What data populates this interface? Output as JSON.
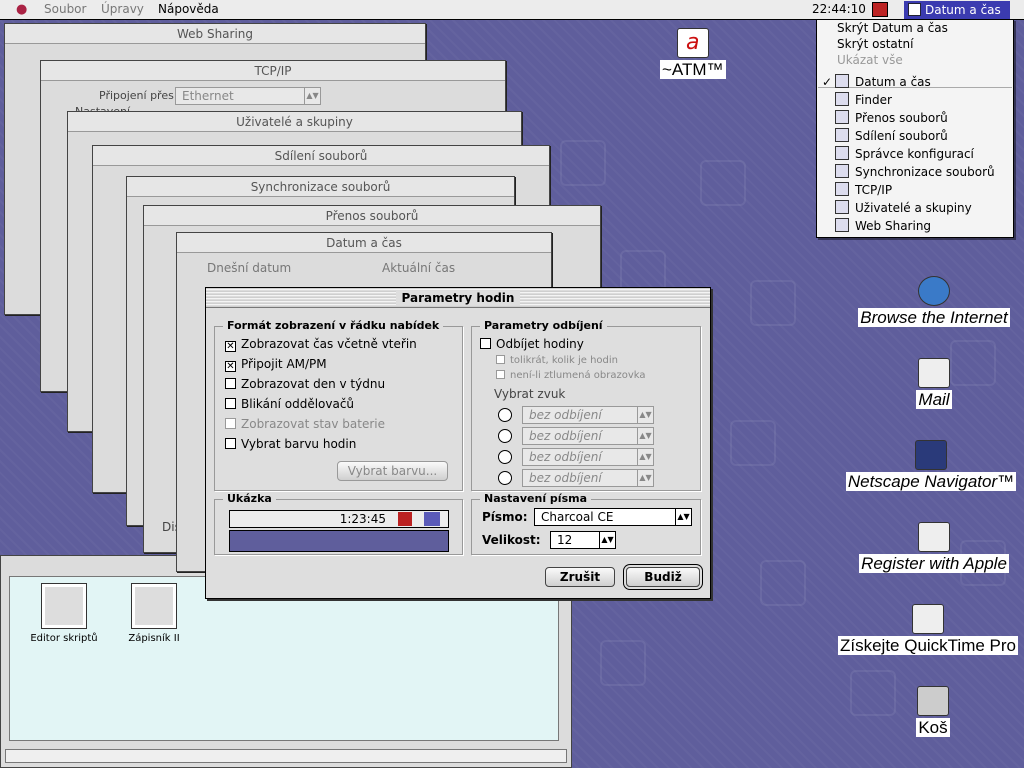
{
  "menubar": {
    "items": [
      "Soubor",
      "Úpravy",
      "Nápověda"
    ],
    "clock": "22:44:10",
    "app_menu": "Datum a čas"
  },
  "app_dropdown": {
    "top_items": [
      "Skrýt Datum a čas",
      "Skrýt ostatní",
      "Ukázat vše"
    ],
    "apps": [
      "Datum a čas",
      "Finder",
      "Přenos souborů",
      "Sdílení souborů",
      "Správce konfigurací",
      "Synchronizace souborů",
      "TCP/IP",
      "Uživatelé a skupiny",
      "Web Sharing"
    ],
    "checked": "Datum a čas"
  },
  "background_windows": {
    "web_sharing": "Web Sharing",
    "tcpip": "TCP/IP",
    "tcpip_connect_label": "Připojení přes:",
    "tcpip_connect_value": "Ethernet",
    "tcpip_settings": "Nastavení",
    "users": "Uživatelé a skupiny",
    "file_sharing": "Sdílení souborů",
    "sync": "Synchronizace souborů",
    "transfer": "Přenos souborů",
    "datetime": "Datum a čas",
    "today": "Dnešní datum",
    "current_time": "Aktuální čas",
    "dis": "Dis"
  },
  "dialog": {
    "title": "Parametry hodin",
    "menubar_group": "Formát zobrazení v řádku nabídek",
    "show_seconds": "Zobrazovat čas včetně vteřin",
    "ampm": "Připojit AM/PM",
    "weekday": "Zobrazovat den v týdnu",
    "blink": "Blikání oddělovačů",
    "battery": "Zobrazovat stav baterie",
    "color": "Vybrat barvu hodin",
    "choose_color": "Vybrat barvu...",
    "chime_group": "Parametry odbíjení",
    "chime": "Odbíjet hodiny",
    "times": "tolikrát, kolik je hodin",
    "dimmed": "není-li ztlumená obrazovka",
    "choose_sound": "Vybrat zvuk",
    "sounds": [
      "bez odbíjení",
      "bez odbíjení",
      "bez odbíjení",
      "bez odbíjení"
    ],
    "preview_group": "Ukázka",
    "preview_time": "1:23:45",
    "font_group": "Nastavení písma",
    "font_label": "Písmo:",
    "font_value": "Charcoal CE",
    "size_label": "Velikost:",
    "size_value": "12",
    "cancel": "Zrušit",
    "ok": "Budiž"
  },
  "desktop": {
    "atm": "~ATM™",
    "icons": [
      "Browse the Internet",
      "Mail",
      "Netscape Navigator™",
      "Register with Apple",
      "Získejte QuickTime Pro",
      "Koš"
    ]
  },
  "bottom_window": {
    "items": [
      "Editor skriptů",
      "Zápisník II"
    ]
  },
  "colors": {
    "desktop": "#5f5e9c",
    "highlight": "#3b3bb0"
  }
}
